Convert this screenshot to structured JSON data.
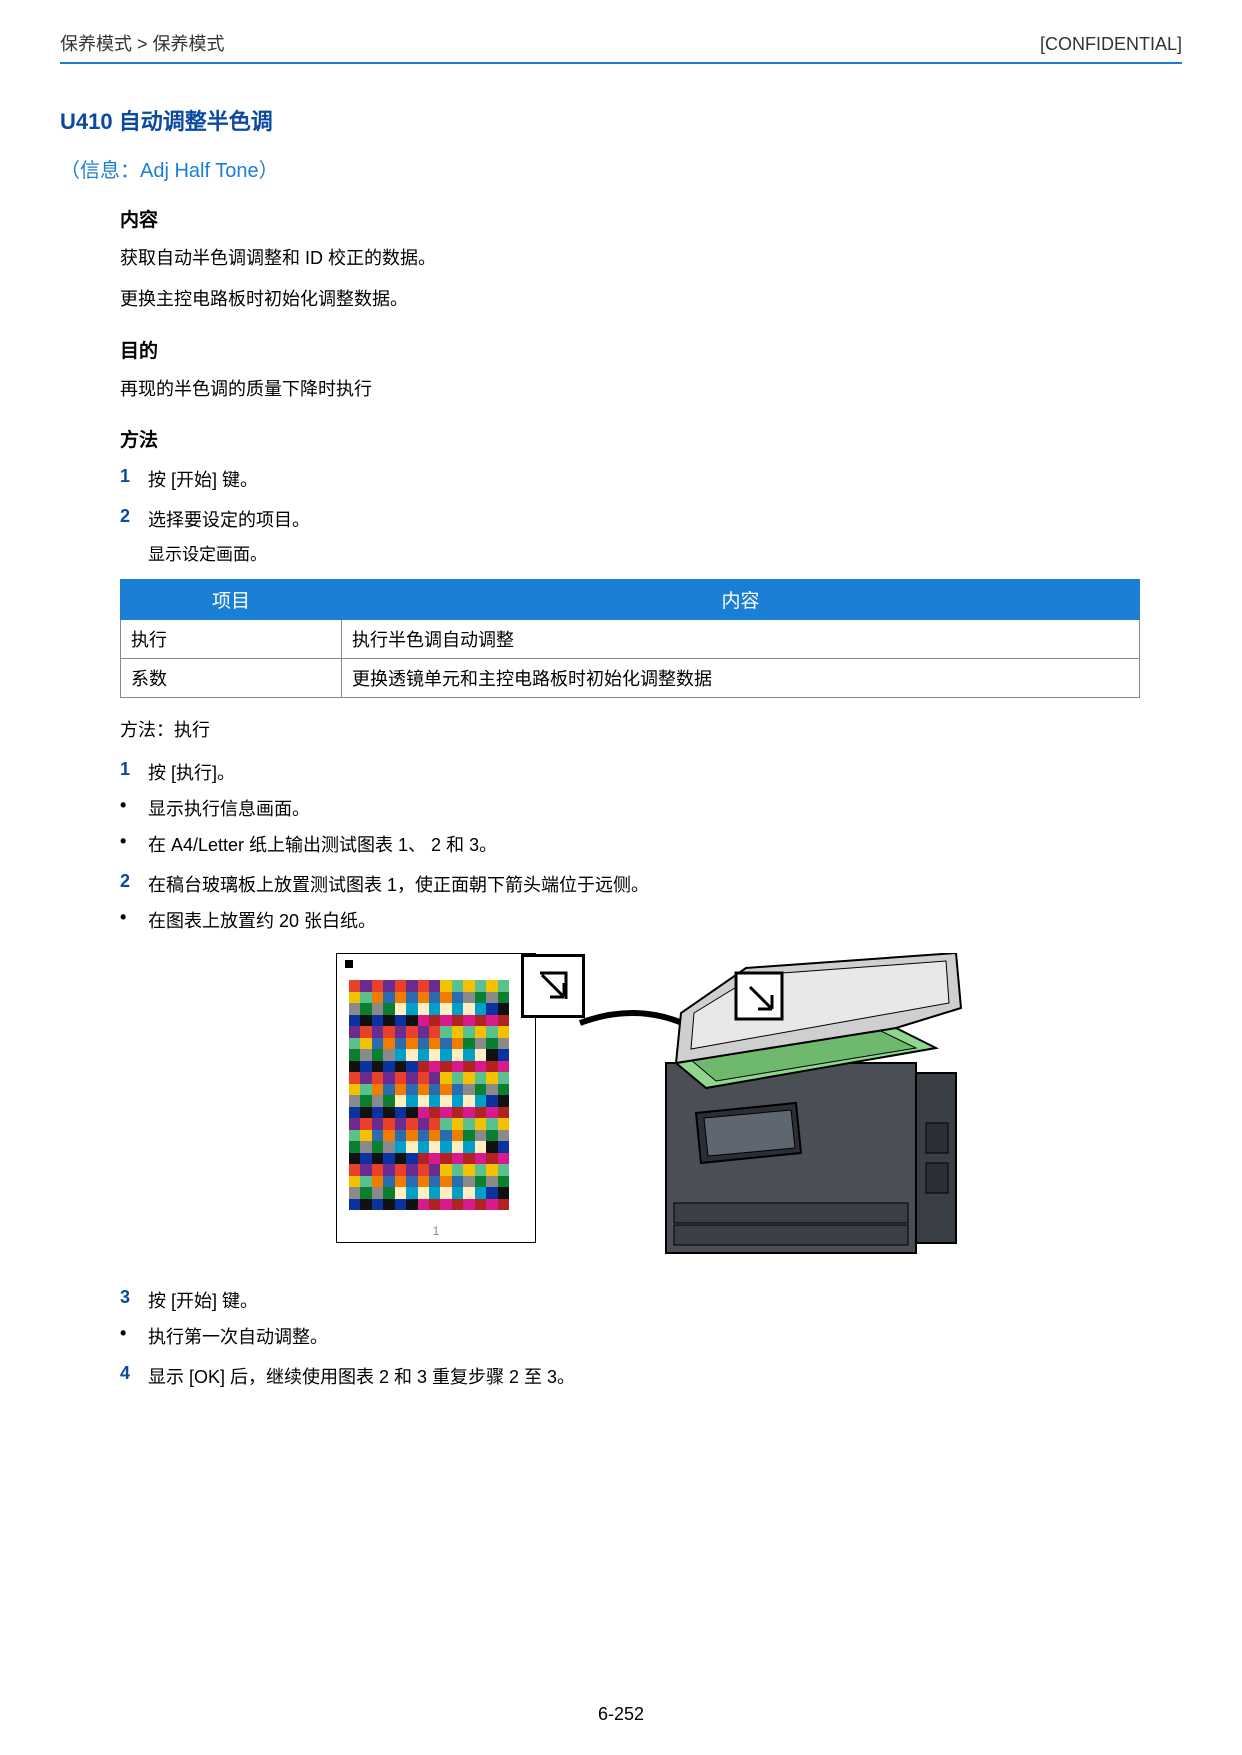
{
  "header": {
    "breadcrumb": "保养模式 > 保养模式",
    "confidential": "[CONFIDENTIAL]"
  },
  "title": "U410 自动调整半色调",
  "subtitle": "（信息：Adj Half Tone）",
  "sections": {
    "content_h": "内容",
    "content_1": "获取自动半色调调整和 ID 校正的数据。",
    "content_2": "更换主控电路板时初始化调整数据。",
    "purpose_h": "目的",
    "purpose_1": "再现的半色调的质量下降时执行",
    "method_h": "方法",
    "step1": "按 [开始] 键。",
    "step2": "选择要设定的项目。",
    "step2_sub": "显示设定画面。"
  },
  "table": {
    "headers": [
      "项目",
      "内容"
    ],
    "rows": [
      [
        "执行",
        "执行半色调自动调整"
      ],
      [
        "系数",
        "更换透镜单元和主控电路板时初始化调整数据"
      ]
    ]
  },
  "method2_h": "方法：执行",
  "m2": {
    "s1": "按 [执行]。",
    "b1": "显示执行信息画面。",
    "b2": "在 A4/Letter 纸上输出测试图表 1、 2 和 3。",
    "s2": "在稿台玻璃板上放置测试图表 1，使正面朝下箭头端位于远侧。",
    "b3": "在图表上放置约 20 张白纸。",
    "s3": "按 [开始] 键。",
    "b4": "执行第一次自动调整。",
    "s4": "显示 [OK] 后，继续使用图表 2 和 3 重复步骤 2 至 3。"
  },
  "figure_label": "1",
  "page_number": "6-252"
}
